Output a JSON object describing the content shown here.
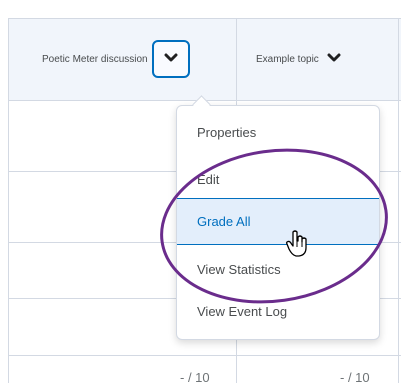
{
  "columns": [
    {
      "title": "Poetic Meter discussion",
      "menu_icon": "chevron-down-icon"
    },
    {
      "title": "Example topic",
      "menu_icon": "chevron-down-icon"
    }
  ],
  "menu": {
    "items": [
      {
        "label": "Properties",
        "selected": false
      },
      {
        "label": "Edit",
        "selected": false
      },
      {
        "label": "Grade All",
        "selected": true
      },
      {
        "label": "View Statistics",
        "selected": false
      },
      {
        "label": "View Event Log",
        "selected": false
      }
    ]
  },
  "grades": {
    "col1": "- / 10",
    "col2": "- / 10"
  },
  "annotation": {
    "color": "#6a2c8c",
    "shape": "ellipse"
  },
  "colors": {
    "accent": "#006fbf",
    "header_bg": "#f1f5fb",
    "selected_bg": "#e3eefb"
  }
}
